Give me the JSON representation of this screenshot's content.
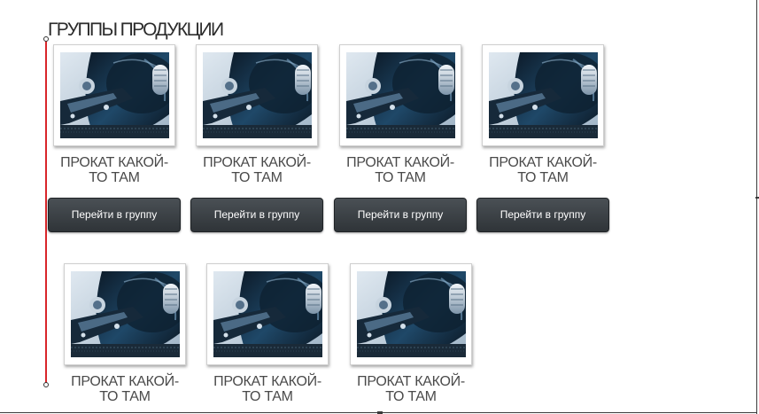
{
  "section": {
    "title": "ГРУППЫ ПРОДУКЦИИ"
  },
  "groups_row1": [
    {
      "title_line1": "ПРОКАТ КАКОЙ-",
      "title_line2": "ТО ТАМ",
      "button_label": "Перейти в группу"
    },
    {
      "title_line1": "ПРОКАТ КАКОЙ-",
      "title_line2": "ТО ТАМ",
      "button_label": "Перейти в группу"
    },
    {
      "title_line1": "ПРОКАТ КАКОЙ-",
      "title_line2": "ТО ТАМ",
      "button_label": "Перейти в группу"
    },
    {
      "title_line1": "ПРОКАТ КАКОЙ-",
      "title_line2": "ТО ТАМ",
      "button_label": "Перейти в группу"
    }
  ],
  "groups_row2": [
    {
      "title_line1": "ПРОКАТ КАКОЙ-",
      "title_line2": "ТО ТАМ"
    },
    {
      "title_line1": "ПРОКАТ КАКОЙ-",
      "title_line2": "ТО ТАМ"
    },
    {
      "title_line1": "ПРОКАТ КАКОЙ-",
      "title_line2": "ТО ТАМ"
    }
  ],
  "colors": {
    "guide": "#d9262a",
    "button": "#3a3f43",
    "title_text": "#4a4a4a"
  },
  "icons": {
    "thumbnail": "hard-drive-photo"
  }
}
